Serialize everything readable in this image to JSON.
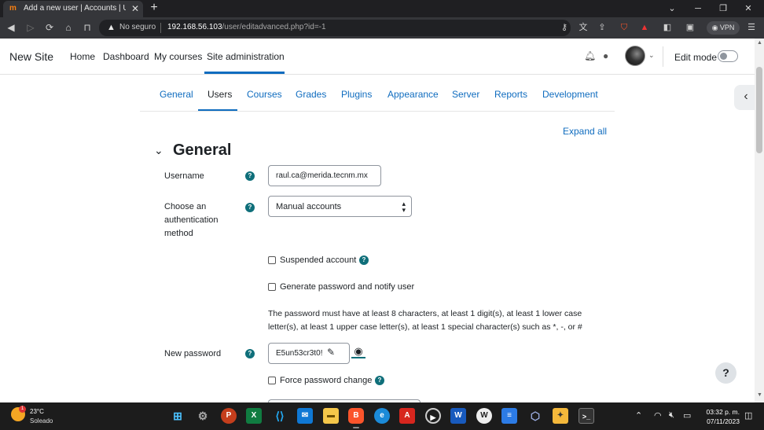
{
  "browser": {
    "tab_title": "Add a new user | Accounts | User",
    "tab_favicon": "moodle-icon",
    "security_label": "No seguro",
    "url_host": "192.168.56.103",
    "url_path": "/user/editadvanced.php?id=-1",
    "vpn_label": "VPN"
  },
  "site": {
    "name": "New Site",
    "primary_nav": [
      "Home",
      "Dashboard",
      "My courses",
      "Site administration"
    ],
    "edit_mode_label": "Edit mode"
  },
  "secondary_nav": [
    "General",
    "Users",
    "Courses",
    "Grades",
    "Plugins",
    "Appearance",
    "Server",
    "Reports",
    "Development"
  ],
  "form": {
    "expand_all": "Expand all",
    "section_title": "General",
    "username_label": "Username",
    "username_value": "raul.ca@merida.tecnm.mx",
    "auth_label": "Choose an authentication method",
    "auth_value": "Manual accounts",
    "suspended_label": "Suspended account",
    "generate_password_label": "Generate password and notify user",
    "password_rules": "The password must have at least 8 characters, at least 1 digit(s), at least 1 lower case letter(s), at least 1 upper case letter(s), at least 1 special character(s) such as *, -, or #",
    "new_password_label": "New password",
    "new_password_value": "E5un53cr3t0!",
    "force_change_label": "Force password change"
  },
  "help_fab": "?",
  "taskbar": {
    "temperature": "23°C",
    "weather": "Soleado",
    "weather_badge": "1",
    "time": "03:32 p. m.",
    "date": "07/11/2023"
  },
  "colors": {
    "accent": "#0f6cbf",
    "help_icon": "#0f6f7a",
    "browser_chrome": "#35363a"
  }
}
